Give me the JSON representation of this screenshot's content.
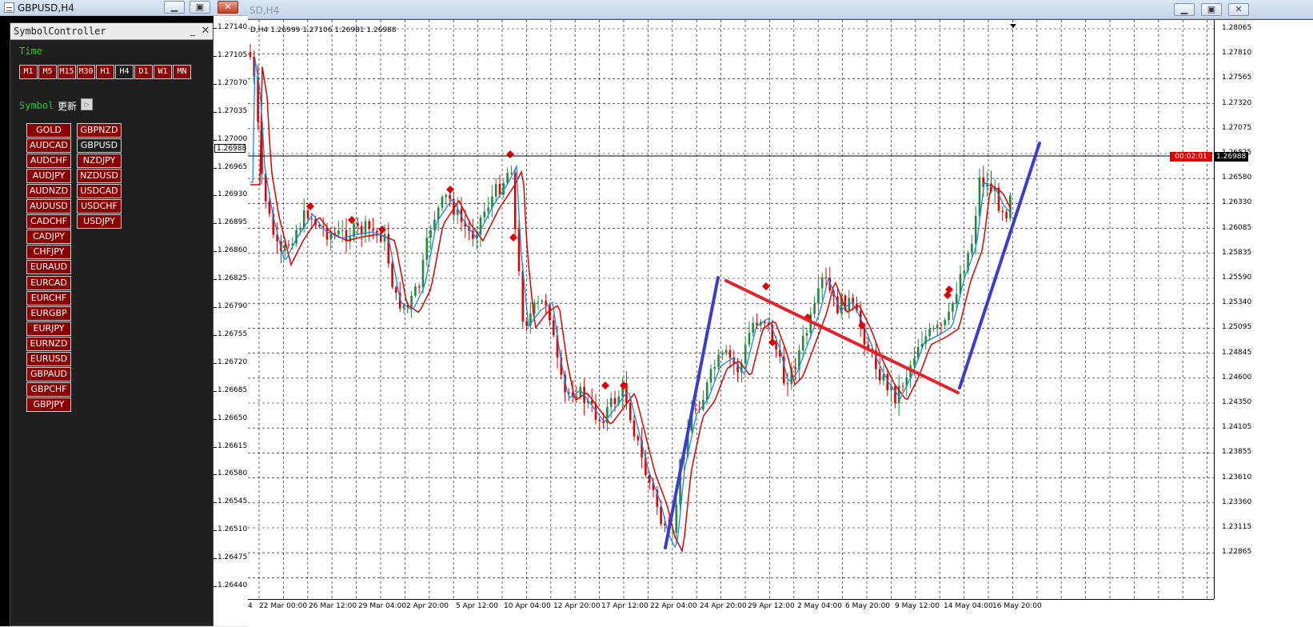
{
  "left_window": {
    "title": "GBPUSD,H4",
    "buttons": {
      "minimize": "▁",
      "restore": "▣",
      "close": "✕"
    },
    "price_scale": [
      "1.27140",
      "1.27105",
      "1.27070",
      "1.27035",
      "1.27000",
      "1.26965",
      "1.26930",
      "1.26895",
      "1.26860",
      "1.26825",
      "1.26790",
      "1.26755",
      "1.26720",
      "1.26685",
      "1.26650",
      "1.26615",
      "1.26580",
      "1.26545",
      "1.26510",
      "1.26475",
      "1.26440"
    ],
    "current_price": "1.26988"
  },
  "controller": {
    "title": "SymbolController",
    "minimize": "_",
    "close": "✕",
    "time_label": "Time",
    "timeframes": [
      {
        "label": "M1",
        "active": false
      },
      {
        "label": "M5",
        "active": false
      },
      {
        "label": "M15",
        "active": false
      },
      {
        "label": "M30",
        "active": false
      },
      {
        "label": "H1",
        "active": false
      },
      {
        "label": "H4",
        "active": true
      },
      {
        "label": "D1",
        "active": false
      },
      {
        "label": "W1",
        "active": false
      },
      {
        "label": "MN",
        "active": false
      }
    ],
    "symbol_label": "Symbol",
    "refresh_label": "更新",
    "refresh_icon": "▷",
    "symbols_col1": [
      {
        "label": "GOLD",
        "active": false
      },
      {
        "label": "AUDCAD",
        "active": false
      },
      {
        "label": "AUDCHF",
        "active": false
      },
      {
        "label": "AUDJPY",
        "active": false
      },
      {
        "label": "AUDNZD",
        "active": false
      },
      {
        "label": "AUDUSD",
        "active": false
      },
      {
        "label": "CADCHF",
        "active": false
      },
      {
        "label": "CADJPY",
        "active": false
      },
      {
        "label": "CHFJPY",
        "active": false
      },
      {
        "label": "EURAUD",
        "active": false
      },
      {
        "label": "EURCAD",
        "active": false
      },
      {
        "label": "EURCHF",
        "active": false
      },
      {
        "label": "EURGBP",
        "active": false
      },
      {
        "label": "EURJPY",
        "active": false
      },
      {
        "label": "EURNZD",
        "active": false
      },
      {
        "label": "EURUSD",
        "active": false
      },
      {
        "label": "GBPAUD",
        "active": false
      },
      {
        "label": "GBPCHF",
        "active": false
      },
      {
        "label": "GBPJPY",
        "active": false
      }
    ],
    "symbols_col2": [
      {
        "label": "GBPNZD",
        "active": false
      },
      {
        "label": "GBPUSD",
        "active": true
      },
      {
        "label": "NZDJPY",
        "active": false
      },
      {
        "label": "NZDUSD",
        "active": false
      },
      {
        "label": "USDCAD",
        "active": false
      },
      {
        "label": "USDCHF",
        "active": false
      },
      {
        "label": "USDJPY",
        "active": false
      }
    ]
  },
  "main_window": {
    "title": "SD,H4",
    "buttons": {
      "minimize": "▁",
      "restore": "▣",
      "close": "✕"
    },
    "ohlc_text": "D,H4  1.26999 1.27106 1.26981 1.26988",
    "y_ticks": [
      "1.28065",
      "1.27810",
      "1.27565",
      "1.27320",
      "1.27075",
      "1.26825",
      "1.26580",
      "1.26330",
      "1.26085",
      "1.25835",
      "1.25590",
      "1.25340",
      "1.25095",
      "1.24845",
      "1.24600",
      "1.24350",
      "1.24105",
      "1.23855",
      "1.23610",
      "1.23360",
      "1.23115",
      "1.22865"
    ],
    "x_ticks": [
      "4",
      "22 Mar 00:00",
      "26 Mar 12:00",
      "29 Mar 04:00",
      "2 Apr 20:00",
      "5 Apr 12:00",
      "10 Apr 04:00",
      "12 Apr 20:00",
      "17 Apr 12:00",
      "22 Apr 04:00",
      "24 Apr 20:00",
      "29 Apr 12:00",
      "2 May 04:00",
      "6 May 20:00",
      "9 May 12:00",
      "14 May 04:00",
      "16 May 20:00"
    ],
    "bid_price": "1.26988",
    "countdown": "00:02:01",
    "colors": {
      "bull": "#1e8a3c",
      "bear": "#e00000",
      "ma_fast": "#1a86e8",
      "ma_slow": "#e00000",
      "trend_up": "#3c3ccf",
      "trend_down": "#e8202a"
    }
  }
}
